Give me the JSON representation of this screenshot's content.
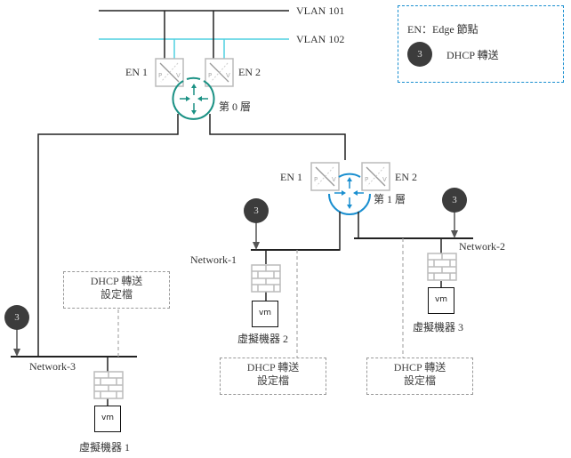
{
  "legend": {
    "edge_label": "EN：Edge  節點",
    "badge_number": "3",
    "dhcp_label": "DHCP  轉送"
  },
  "vlans": [
    {
      "name": "VLAN 101",
      "color": "#222222"
    },
    {
      "name": "VLAN 102",
      "color": "#4fd0e0"
    }
  ],
  "tier0": {
    "label": "第 0  層",
    "color": "#1a9184",
    "edge_nodes": [
      "EN 1",
      "EN 2"
    ]
  },
  "tier1": {
    "label": "第 1 層",
    "color": "#1a8fd0",
    "edge_nodes": [
      "EN 1",
      "EN 2"
    ]
  },
  "networks": [
    {
      "name": "Network-1",
      "vm_label": "vm",
      "vm_name": "虛擬機器 2",
      "config": [
        "DHCP  轉送",
        "設定檔"
      ]
    },
    {
      "name": "Network-2",
      "vm_label": "vm",
      "vm_name": "虛擬機器 3",
      "config": [
        "DHCP  轉送",
        "設定檔"
      ]
    },
    {
      "name": "Network-3",
      "vm_label": "vm",
      "vm_name": "虛擬機器 1",
      "config": [
        "DHCP  轉送",
        "設定檔"
      ]
    }
  ],
  "dhcp_badge": "3"
}
